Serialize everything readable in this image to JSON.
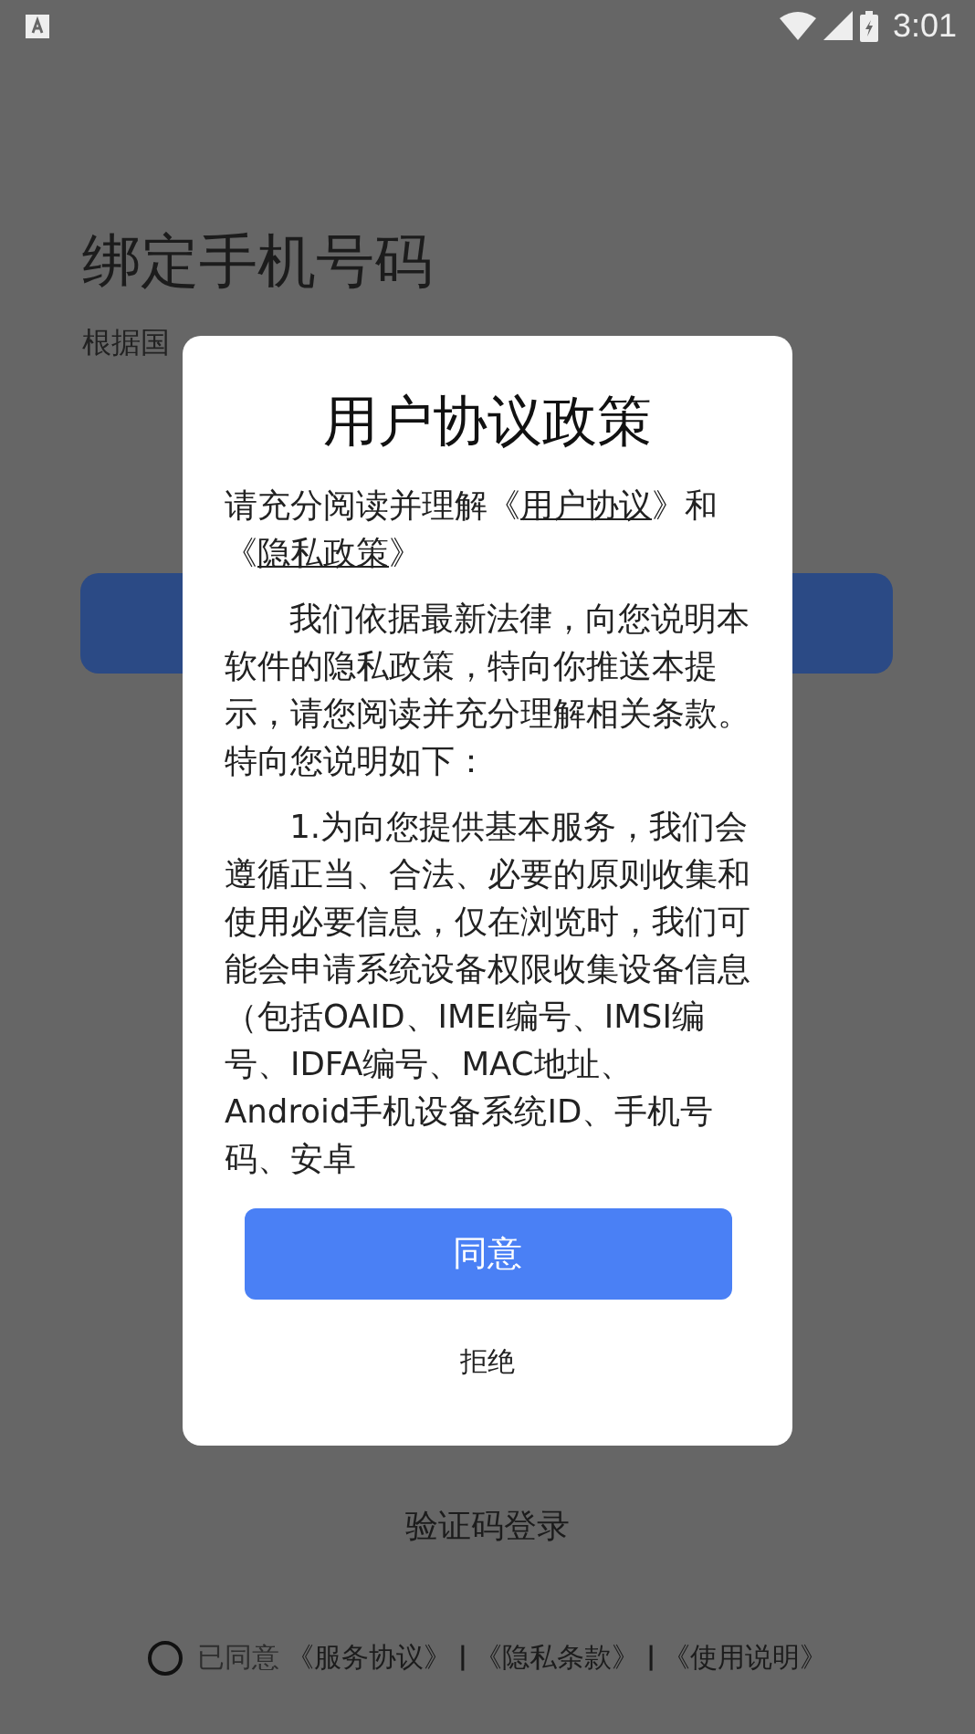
{
  "status_bar": {
    "time": "3:01"
  },
  "page": {
    "title": "绑定手机号码",
    "subtitle": "根据国",
    "link_login": "验证码登录",
    "agreement": {
      "checked": false,
      "prefix": "已同意",
      "links": [
        "《服务协议》",
        "《隐私条款》",
        "《使用说明》"
      ],
      "separator": "|"
    }
  },
  "dialog": {
    "title": "用户协议政策",
    "intro": [
      {
        "kind": "text",
        "text": "请充分阅读并理解《"
      },
      {
        "kind": "link",
        "text": "用户协议"
      },
      {
        "kind": "text",
        "text": "》和《"
      },
      {
        "kind": "link",
        "text": "隐私政策"
      },
      {
        "kind": "text",
        "text": "》"
      }
    ],
    "paragraphs": [
      "我们依据最新法律，向您说明本软件的隐私政策，特向你推送本提示，请您阅读并充分理解相关条款。特向您说明如下：",
      "1.为向您提供基本服务，我们会遵循正当、合法、必要的原则收集和使用必要信息，仅在浏览时，我们可能会申请系统设备权限收集设备信息（包括OAID、IMEI编号、IMSI编号、IDFA编号、MAC地址、Android手机设备系统ID、手机号码、安卓"
    ],
    "buttons": [
      {
        "kind": "primary",
        "label": "同意"
      },
      {
        "kind": "plain",
        "label": "拒绝"
      }
    ]
  }
}
